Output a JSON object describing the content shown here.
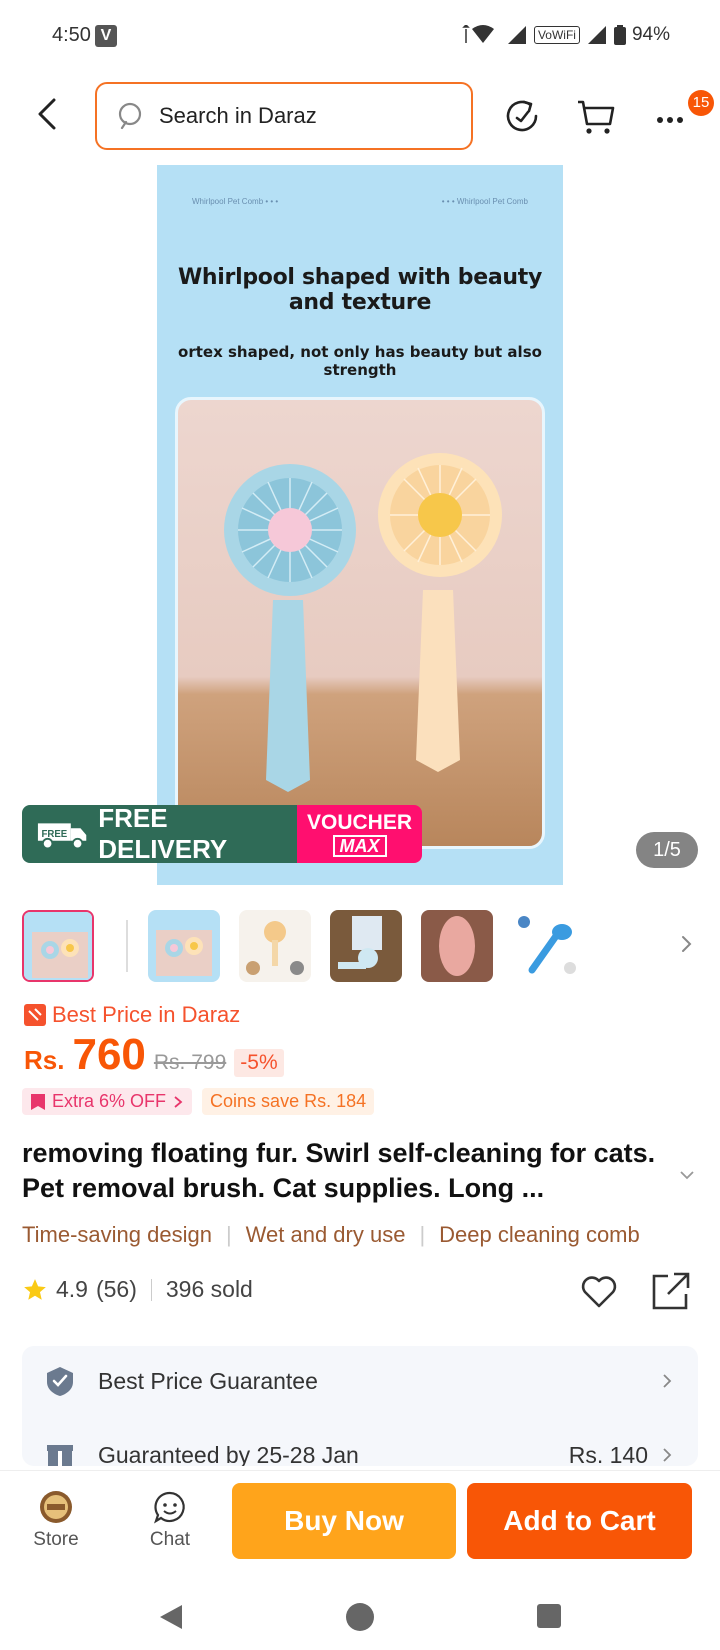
{
  "status_bar": {
    "time": "4:50",
    "carrier_badge": "V",
    "vowifi": "VoWiFi",
    "battery": "94%"
  },
  "header": {
    "search_placeholder": "Search in Daraz",
    "cart_badge": "15"
  },
  "product_image": {
    "top_left_label": "Whirlpool Pet Comb  • • •",
    "top_right_label": "• • •   Whirlpool Pet Comb",
    "headline": "Whirlpool shaped with beauty and texture",
    "subline": "ortex shaped, not only has beauty but also strength",
    "counter": "1/5"
  },
  "free_delivery": {
    "badge_text": "FREE",
    "label": "FREE DELIVERY",
    "voucher": "VOUCHER",
    "max": "MAX"
  },
  "price": {
    "best_price_label": "Best Price in Daraz",
    "currency": "Rs.",
    "value": "760",
    "old_price": "Rs. 799",
    "discount": "-5%",
    "promo_extra": "Extra 6% OFF",
    "promo_coins": "Coins save Rs. 184"
  },
  "product": {
    "title": "removing floating fur. Swirl self-cleaning for cats. Pet removal brush. Cat supplies. Long ...",
    "features": [
      "Time-saving design",
      "Wet and dry use",
      "Deep cleaning comb"
    ],
    "rating": "4.9",
    "reviews": "(56)",
    "sold": "396 sold"
  },
  "guarantee": {
    "best_price": "Best Price Guarantee",
    "delivery": "Guaranteed by 25-28 Jan",
    "delivery_price": "Rs. 140"
  },
  "bottom_bar": {
    "store": "Store",
    "chat": "Chat",
    "buy_now": "Buy Now",
    "add_to_cart": "Add to Cart"
  },
  "colors": {
    "brand": "#f85606",
    "buy_now": "#ffa41b",
    "free_delivery": "#2f6b57",
    "voucher": "#ff0f6f"
  }
}
